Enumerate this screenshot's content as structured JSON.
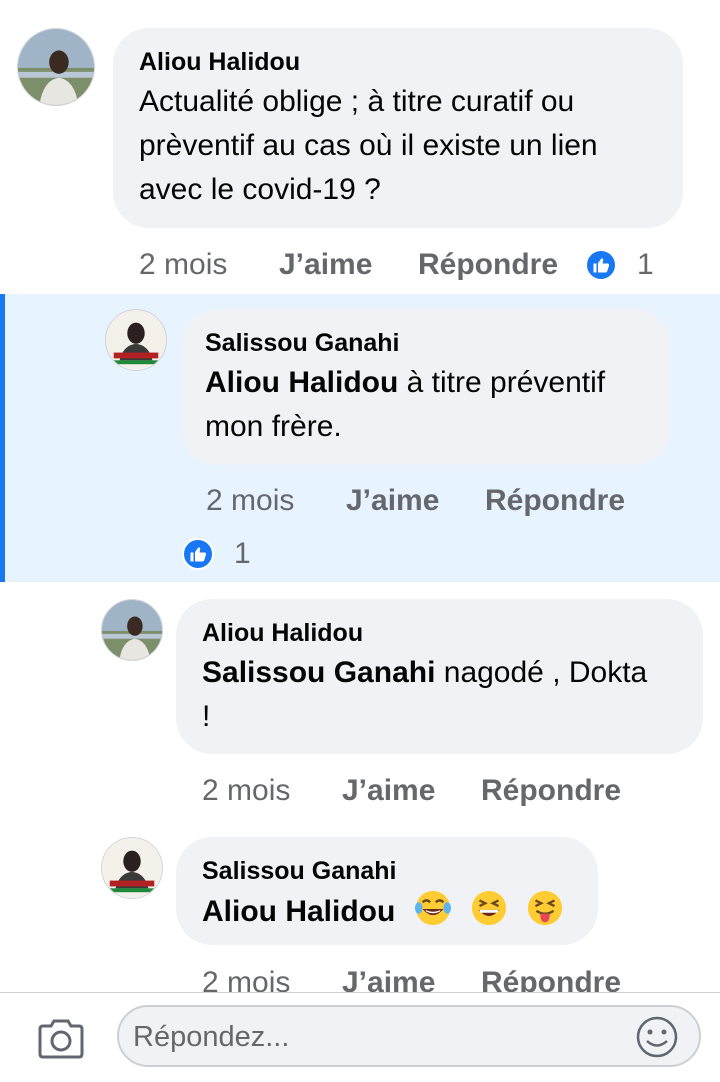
{
  "comments": [
    {
      "author": "Aliou Halidou",
      "lines": [
        "Actualité oblige ; à titre curatif ou",
        "prèventif au cas où il existe un lien",
        "avec le covid-19 ?"
      ],
      "time": "2 mois",
      "like": "J’aime",
      "reply": "Répondre",
      "reaction_count": "1"
    },
    {
      "author": "Salissou Ganahi",
      "mention": "Aliou Halidou",
      "lines": [
        " à titre préventif",
        "mon frère."
      ],
      "time": "2 mois",
      "like": "J’aime",
      "reply": "Répondre",
      "reaction_count": "1"
    },
    {
      "author": "Aliou Halidou",
      "mention": "Salissou Ganahi",
      "lines": [
        " nagodé , Dokta",
        "!"
      ],
      "time": "2 mois",
      "like": "J’aime",
      "reply": "Répondre"
    },
    {
      "author": "Salissou Ganahi",
      "mention": "Aliou Halidou",
      "emojis": [
        "tears-of-joy-emoji",
        "grinning-squinting-emoji",
        "tongue-wink-emoji"
      ],
      "time": "2 mois",
      "like": "J’aime",
      "reply": "Répondre"
    }
  ],
  "composer": {
    "placeholder": "Répondez...",
    "camera_icon": "camera-icon",
    "emoji_icon": "smiley-icon"
  },
  "colors": {
    "accent": "#1877f2",
    "bubble": "#f0f2f5",
    "highlight": "#e7f3ff",
    "meta": "#65676b"
  }
}
